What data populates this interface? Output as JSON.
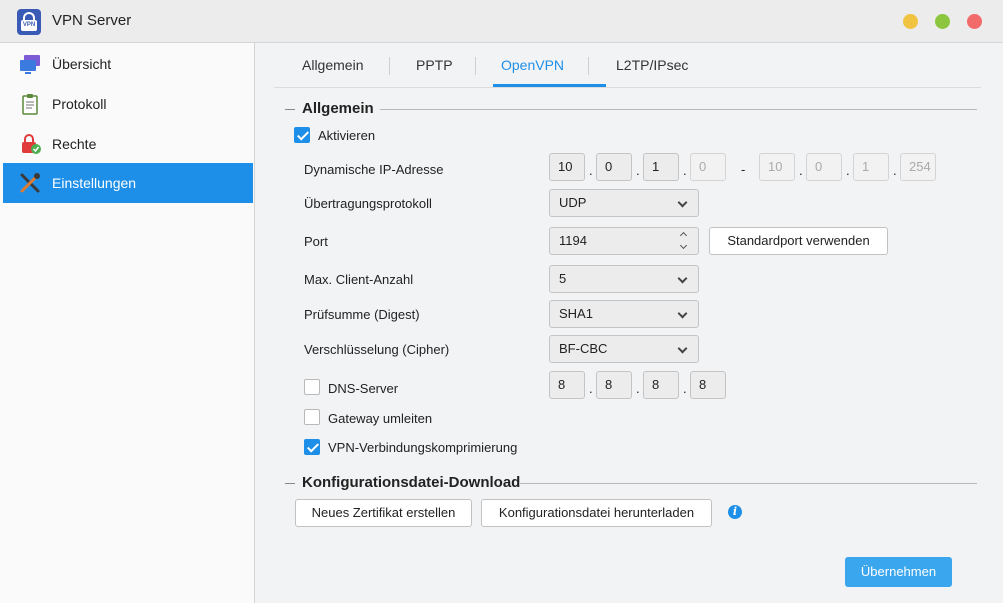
{
  "window": {
    "title": "VPN Server",
    "app_icon_text": "VPN"
  },
  "sidebar": {
    "items": [
      {
        "label": "Übersicht",
        "icon": "monitor-icon"
      },
      {
        "label": "Protokoll",
        "icon": "clipboard-icon"
      },
      {
        "label": "Rechte",
        "icon": "lock-check-icon"
      },
      {
        "label": "Einstellungen",
        "icon": "tools-icon",
        "active": true
      }
    ]
  },
  "tabs": [
    {
      "label": "Allgemein"
    },
    {
      "label": "PPTP"
    },
    {
      "label": "OpenVPN",
      "active": true
    },
    {
      "label": "L2TP/IPsec"
    }
  ],
  "general": {
    "section_title": "Allgemein",
    "enable_label": "Aktivieren",
    "enable_checked": true,
    "dynamic_ip_label": "Dynamische IP-Adresse",
    "ip_start": [
      "10",
      "0",
      "1",
      "0"
    ],
    "ip_dash": "-",
    "ip_end": [
      "10",
      "0",
      "1",
      "254"
    ],
    "protocol_label": "Übertragungsprotokoll",
    "protocol_value": "UDP",
    "port_label": "Port",
    "port_value": "1194",
    "default_port_button": "Standardport verwenden",
    "max_clients_label": "Max. Client-Anzahl",
    "max_clients_value": "5",
    "digest_label": "Prüfsumme (Digest)",
    "digest_value": "SHA1",
    "cipher_label": "Verschlüsselung (Cipher)",
    "cipher_value": "BF-CBC",
    "dns_label": "DNS-Server",
    "dns_checked": false,
    "dns_ip": [
      "8",
      "8",
      "8",
      "8"
    ],
    "gateway_label": "Gateway umleiten",
    "gateway_checked": false,
    "compression_label": "VPN-Verbindungskomprimierung",
    "compression_checked": true
  },
  "config": {
    "section_title": "Konfigurationsdatei-Download",
    "new_cert_button": "Neues Zertifikat erstellen",
    "download_button": "Konfigurationsdatei herunterladen",
    "info_glyph": "i"
  },
  "footer": {
    "apply_button": "Übernehmen"
  },
  "colors": {
    "accent": "#1e8fe8",
    "apply": "#3aa6ee"
  }
}
